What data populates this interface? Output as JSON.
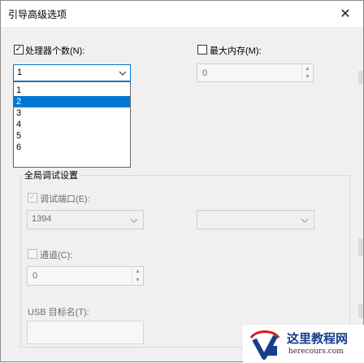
{
  "window": {
    "title": "引导高级选项",
    "close_glyph": "✕"
  },
  "processors": {
    "checkbox_label": "处理器个数(N):",
    "checked": true,
    "selected_value": "1",
    "options": [
      "1",
      "2",
      "3",
      "4",
      "5",
      "6"
    ],
    "highlighted_index": 1
  },
  "max_memory": {
    "checkbox_label": "最大内存(M):",
    "checked": false,
    "value": "0"
  },
  "global_debug": {
    "group_title": "全局调试设置",
    "debug_port_label": "调试端口(E):",
    "debug_port_checked": true,
    "baud_rate_value": "1394",
    "port_value": "",
    "channel_label": "通道(C):",
    "channel_checked": false,
    "channel_value": "0",
    "usb_target_label": "USB 目标名(T):",
    "usb_target_value": ""
  },
  "watermark": {
    "title": "这里教程网",
    "url": "herecours.com"
  },
  "colors": {
    "accent": "#0078d7",
    "watermark_title": "#173d8c"
  }
}
